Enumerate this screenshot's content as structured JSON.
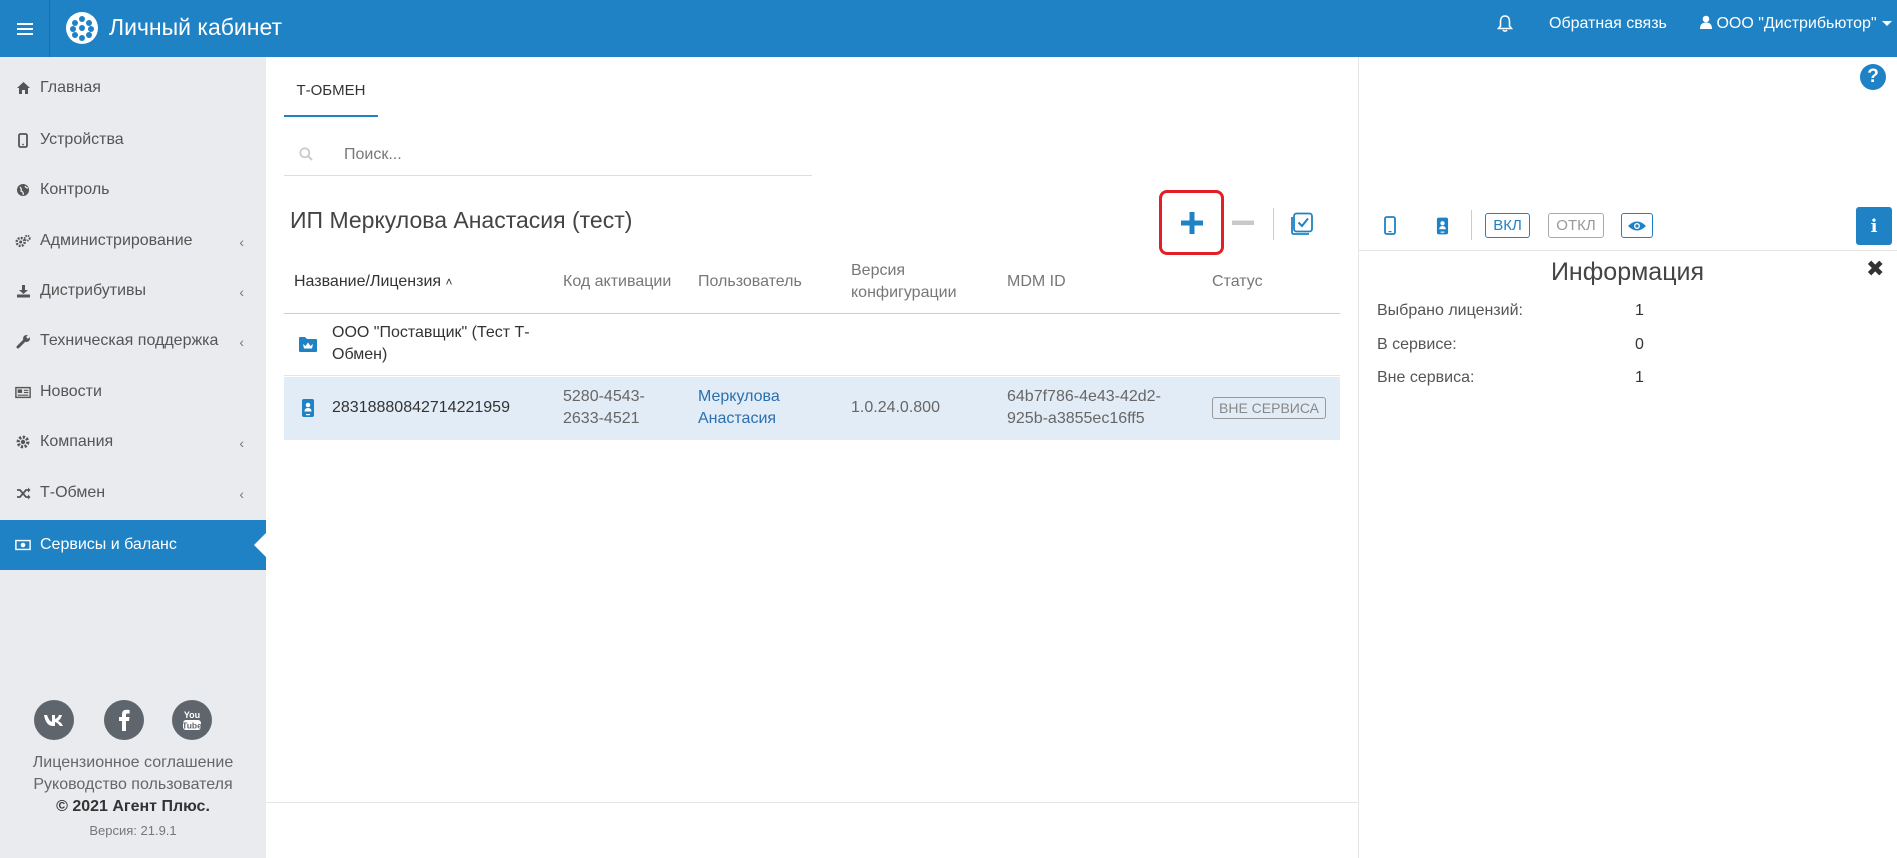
{
  "header": {
    "title": "Личный кабинет",
    "feedback_label": "Обратная связь",
    "user_label": "ООО \"Дистрибьютор\""
  },
  "sidebar": {
    "items": [
      {
        "label": "Главная",
        "icon": "home-icon",
        "has_submenu": false
      },
      {
        "label": "Устройства",
        "icon": "mobile-icon",
        "has_submenu": false
      },
      {
        "label": "Контроль",
        "icon": "globe-icon",
        "has_submenu": false
      },
      {
        "label": "Администрирование",
        "icon": "cogs-icon",
        "has_submenu": true
      },
      {
        "label": "Дистрибутивы",
        "icon": "download-icon",
        "has_submenu": true
      },
      {
        "label": "Техническая поддержка",
        "icon": "wrench-icon",
        "has_submenu": true
      },
      {
        "label": "Новости",
        "icon": "newspaper-icon",
        "has_submenu": false
      },
      {
        "label": "Компания",
        "icon": "gear-icon",
        "has_submenu": true
      },
      {
        "label": "Т-Обмен",
        "icon": "shuffle-icon",
        "has_submenu": true
      },
      {
        "label": "Сервисы и баланс",
        "icon": "money-icon",
        "has_submenu": false,
        "active": true
      }
    ],
    "footer": {
      "license_link": "Лицензионное соглашение",
      "manual_link": "Руководство пользователя",
      "copyright_prefix": "© 2021",
      "copyright_brand": "Агент Плюс.",
      "version": "Версия: 21.9.1"
    }
  },
  "main": {
    "tab_label": "Т-ОБМЕН",
    "search_placeholder": "Поиск...",
    "group_title": "ИП Меркулова Анастасия (тест)",
    "table": {
      "columns": {
        "name": "Название/Лицензия",
        "code": "Код активации",
        "user": "Пользователь",
        "version_line1": "Версия",
        "version_line2": "конфигурации",
        "mdm": "MDM ID",
        "status": "Статус"
      },
      "folder": {
        "line1": "ООО \"Поставщик\" (Тест Т-",
        "line2": "Обмен)"
      },
      "row": {
        "license": "28318880842714221959",
        "code_line1": "5280-4543-",
        "code_line2": "2633-4521",
        "user_line1": "Меркулова",
        "user_line2": "Анастасия",
        "version": "1.0.24.0.800",
        "mdm_line1": "64b7f786-4e43-42d2-",
        "mdm_line2": "925b-a3855ec16ff5",
        "status": "ВНЕ СЕРВИСА"
      }
    }
  },
  "right_panel": {
    "on_label": "ВКЛ",
    "off_label": "ОТКЛ",
    "info_title": "Информация",
    "stats": [
      {
        "label": "Выбрано лицензий:",
        "value": "1"
      },
      {
        "label": "В сервисе:",
        "value": "0"
      },
      {
        "label": "Вне сервиса:",
        "value": "1"
      }
    ]
  },
  "colors": {
    "primary": "#1e82c5",
    "highlight": "#e41e26",
    "selected_row": "#e2ecf6"
  }
}
